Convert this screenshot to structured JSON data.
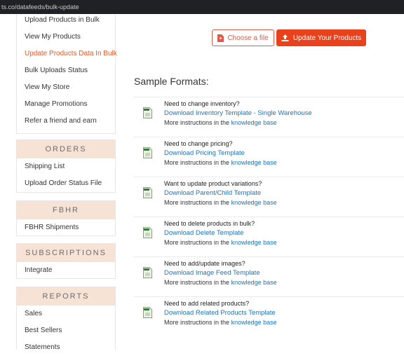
{
  "browser": {
    "url": "ts.co/datafeeds/bulk-update"
  },
  "sidebar": {
    "top_items": [
      {
        "label": "Upload Products in Bulk"
      },
      {
        "label": "View My Products"
      },
      {
        "label": "Update Products Data In Bulk"
      },
      {
        "label": "Bulk Uploads Status"
      },
      {
        "label": "View My Store"
      },
      {
        "label": "Manage Promotions"
      },
      {
        "label": "Refer a friend and earn"
      }
    ],
    "orders": {
      "heading": "ORDERS",
      "items": [
        {
          "label": "Shipping List"
        },
        {
          "label": "Upload Order Status File"
        }
      ]
    },
    "fbhr": {
      "heading": "FBHR",
      "items": [
        {
          "label": "FBHR Shipments"
        }
      ]
    },
    "subscriptions": {
      "heading": "SUBSCRIPTIONS",
      "items": [
        {
          "label": "Integrate"
        }
      ]
    },
    "reports": {
      "heading": "REPORTS",
      "items": [
        {
          "label": "Sales"
        },
        {
          "label": "Best Sellers"
        },
        {
          "label": "Statements"
        }
      ]
    }
  },
  "actions": {
    "choose_label": "Choose a file",
    "update_label": "Update Your Products"
  },
  "samples": {
    "title": "Sample Formats:",
    "more_prefix": "More instructions in the",
    "kb_link": "knowledge base",
    "rows": [
      {
        "question": "Need to change inventory?",
        "link": "Download Inventory Template - Single Warehouse"
      },
      {
        "question": "Need to change pricing?",
        "link": "Download Pricing Template"
      },
      {
        "question": "Want to update product variations?",
        "link": "Download Parent/Child Template"
      },
      {
        "question": "Need to delete products in bulk?",
        "link": "Download Delete Template"
      },
      {
        "question": "Need to add/update images?",
        "link": "Download Image Feed Template"
      },
      {
        "question": "Need to add related products?",
        "link": "Download Related Products Template"
      }
    ]
  },
  "colors": {
    "accent": "#e8411b",
    "active": "#ea5a2a",
    "link": "#1a73c8",
    "section_bg": "#f6e3d6"
  }
}
